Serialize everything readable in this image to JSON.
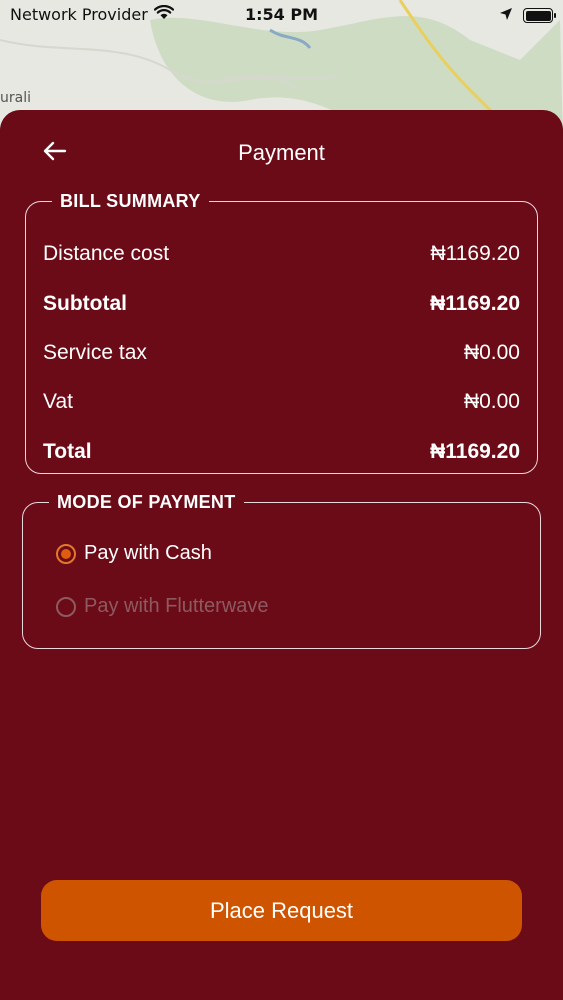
{
  "status_bar": {
    "carrier": "Network Provider",
    "time": "1:54 PM",
    "icons": [
      "wifi-icon",
      "location-arrow-icon",
      "battery-icon"
    ]
  },
  "map": {
    "place_label": "urali"
  },
  "header": {
    "back_icon": "arrow-left-icon",
    "title": "Payment"
  },
  "bill_summary": {
    "legend": "BILL SUMMARY",
    "rows": [
      {
        "label": "Distance cost",
        "value": "₦1169.20",
        "bold": false
      },
      {
        "label": "Subtotal",
        "value": "₦1169.20",
        "bold": true
      },
      {
        "label": "Service tax",
        "value": "₦0.00",
        "bold": false
      },
      {
        "label": "Vat",
        "value": "₦0.00",
        "bold": false
      },
      {
        "label": "Total",
        "value": "₦1169.20",
        "bold": true
      }
    ]
  },
  "payment_mode": {
    "legend": "MODE OF PAYMENT",
    "options": [
      {
        "label": "Pay with Cash",
        "selected": true,
        "enabled": true
      },
      {
        "label": "Pay with Flutterwave",
        "selected": false,
        "enabled": false
      }
    ]
  },
  "actions": {
    "place_request_label": "Place Request"
  },
  "colors": {
    "sheet_background": "#6b0b17",
    "accent": "#cf5400",
    "radio_selected": "#e05d10"
  }
}
